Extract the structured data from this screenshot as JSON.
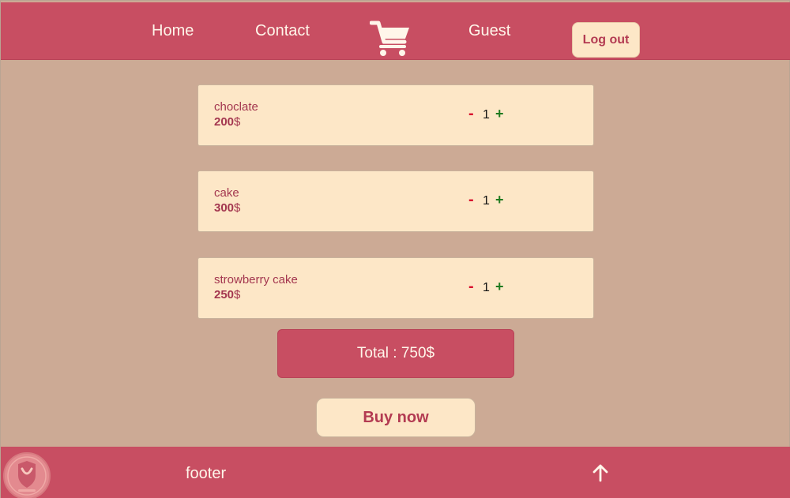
{
  "nav": {
    "home_label": "Home",
    "contact_label": "Contact",
    "cart_icon": "shopping-cart-icon",
    "guest_label": "Guest",
    "logout_label": "Log out"
  },
  "cart": {
    "items": [
      {
        "name": "choclate",
        "price": "200",
        "currency": "$",
        "qty": "1",
        "minus": "-",
        "plus": "+"
      },
      {
        "name": "cake",
        "price": "300",
        "currency": "$",
        "qty": "1",
        "minus": "-",
        "plus": "+"
      },
      {
        "name": "strowberry cake",
        "price": "250",
        "currency": "$",
        "qty": "1",
        "minus": "-",
        "plus": "+"
      }
    ],
    "total_label": "Total : 750$",
    "buy_label": "Buy now"
  },
  "footer": {
    "text": "footer",
    "up_icon": "arrow-up-icon",
    "logo_icon": "shield-logo-icon"
  },
  "colors": {
    "brand": "#c84e62",
    "background": "#ccaa95",
    "card": "#fde7c7",
    "minus": "#d8102e",
    "plus": "#1e7a1e"
  }
}
